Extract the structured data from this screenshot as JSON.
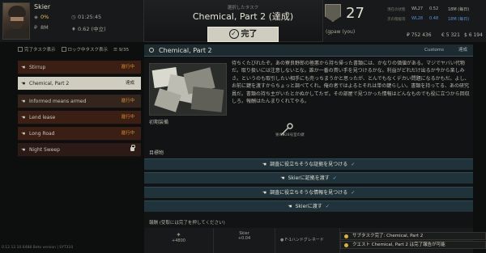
{
  "trader": {
    "name": "Skier",
    "standing": "0%",
    "money": "8M",
    "time": "01:25:45",
    "loyalty": "0.62 (中立)"
  },
  "task_header": {
    "subtitle": "選択したタスク",
    "title": "Chemical, Part 2 (達成)",
    "complete_label": "完了"
  },
  "player": {
    "level": "27",
    "username": "(gpaw (you)",
    "faction_label_1": "現在の状態",
    "faction_label_2": "次の階級等",
    "val_1a": "WL27",
    "val_1b": "0.52",
    "val_1c": "18M (毎日)",
    "val_2a": "WL28",
    "val_2b": "0.48",
    "val_2c": "18M (毎日)",
    "roubles": "₽ 752 436",
    "dollars": "€ 5 321",
    "euros": "$ 6 194"
  },
  "filters": {
    "show_completed": "完了タスク表示",
    "show_locked": "ロック中タスク表示",
    "count": "9/35"
  },
  "quests": [
    {
      "name": "Stirrup",
      "state": "進行中",
      "icon": "hand-icon"
    },
    {
      "name": "Chemical, Part 2",
      "state": "達成",
      "icon": "hand-icon"
    },
    {
      "name": "Informed means armed",
      "state": "進行中",
      "icon": "hand-icon"
    },
    {
      "name": "Lend lease",
      "state": "進行中",
      "icon": "hand-icon"
    },
    {
      "name": "Long Road",
      "state": "進行中",
      "icon": "hand-icon"
    },
    {
      "name": "Night Sweep",
      "state": "",
      "icon": "lock-icon"
    }
  ],
  "main": {
    "header_title": "Chemical, Part 2",
    "header_trader": "Customs",
    "header_state": "達成",
    "description": "待ちくたびれたぞ。あの寮良野郎の極悪から持ち帰った書類には、かなりの価値がある。マジでヤバい代物だ。取り扱いには注意しないとな。誰か一番の貰い手を見つけるかな。利益がどれだけ出るか今から楽しみさ。というのも取引したい相手にも売っちまうかと思ったが、とんでもなくデカい問題になるかもだ。よし、お前に鍵を渡すからちょっと調べてくれ。俺の者ではよるとそれは単の鍵らしい。書類を持ってる、あの研究員だ。書類の持ち主がいたとかぬかしてたぜ。その部屋で見つかった情報はどんなものでも役に立つから回収しろ。報酬はたんまりくれてやる。",
    "equipment_label": "初期装備",
    "equipment_item": "寮の228号室の鍵",
    "objectives_label": "目標物",
    "objectives": [
      "調査に役立ちそうな証拠を見つける",
      "Skierに証拠を渡す",
      "調査に役立ちそうな情報を見つける",
      "Skierに渡す"
    ],
    "rewards_label": "報酬 (受取には完了を押してください)",
    "reward_exp": "+4800",
    "reward_standing_name": "Skier",
    "reward_standing": "+0.04",
    "reward_item": "F-1ハンドグレネード"
  },
  "notifications": [
    "サブタスク完了: Chemical, Part 2",
    "クエスト Chemical, Part 2 は完了報告が可能"
  ],
  "version": "0.12.12.10.6488 Beta version | SYT310"
}
